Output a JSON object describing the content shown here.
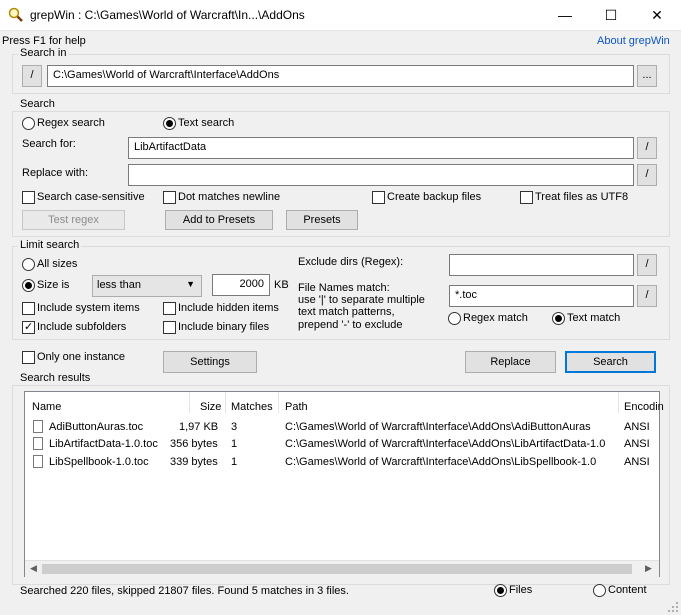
{
  "window": {
    "title": "grepWin : C:\\Games\\World of Warcraft\\In...\\AddOns",
    "minimize": "—",
    "maximize": "☐",
    "close": "✕"
  },
  "help_text": "Press F1 for help",
  "about_link": "About grepWin",
  "search_in": {
    "legend": "Search in",
    "slash_label": "/",
    "path": "C:\\Games\\World of Warcraft\\Interface\\AddOns",
    "browse_label": "..."
  },
  "search": {
    "legend": "Search",
    "regex_label": "Regex search",
    "text_label": "Text search",
    "search_for_label": "Search for:",
    "search_for_value": "LibArtifactData",
    "replace_label": "Replace with:",
    "replace_value": "",
    "slash_label": "/",
    "case_label": "Search case-sensitive",
    "dot_label": "Dot matches newline",
    "backup_label": "Create backup files",
    "utf8_label": "Treat files as UTF8",
    "test_regex_label": "Test regex",
    "add_presets_label": "Add to Presets",
    "presets_label": "Presets"
  },
  "limit": {
    "legend": "Limit search",
    "all_sizes_label": "All sizes",
    "size_is_label": "Size is",
    "size_op": "less than",
    "size_value": "2000",
    "size_unit": "KB",
    "system_label": "Include system items",
    "hidden_label": "Include hidden items",
    "subfolders_label": "Include subfolders",
    "binary_label": "Include binary files",
    "exclude_label": "Exclude dirs (Regex):",
    "exclude_value": "",
    "file_names_label": "File Names match:",
    "file_names_hint1": "use '|' to separate multiple",
    "file_names_hint2": "text match patterns,",
    "file_names_hint3": "prepend '-' to exclude",
    "file_names_value": "*.toc",
    "regex_match_label": "Regex match",
    "text_match_label": "Text match",
    "slash_label": "/"
  },
  "actions": {
    "one_instance_label": "Only one instance",
    "settings_label": "Settings",
    "replace_label": "Replace",
    "search_label": "Search"
  },
  "results": {
    "legend": "Search results",
    "columns": [
      "Name",
      "Size",
      "Matches",
      "Path",
      "Encodin"
    ],
    "rows": [
      {
        "name": "AdiButtonAuras.toc",
        "size": "1,97 KB",
        "matches": "3",
        "path": "C:\\Games\\World of Warcraft\\Interface\\AddOns\\AdiButtonAuras",
        "encoding": "ANSI"
      },
      {
        "name": "LibArtifactData-1.0.toc",
        "size": "356 bytes",
        "matches": "1",
        "path": "C:\\Games\\World of Warcraft\\Interface\\AddOns\\LibArtifactData-1.0",
        "encoding": "ANSI"
      },
      {
        "name": "LibSpellbook-1.0.toc",
        "size": "339 bytes",
        "matches": "1",
        "path": "C:\\Games\\World of Warcraft\\Interface\\AddOns\\LibSpellbook-1.0",
        "encoding": "ANSI"
      }
    ]
  },
  "status": {
    "text": "Searched 220 files, skipped 21807 files. Found 5 matches in 3 files.",
    "files_label": "Files",
    "content_label": "Content"
  },
  "colors": {
    "accent": "#0078d7",
    "link": "#0a55c8"
  }
}
